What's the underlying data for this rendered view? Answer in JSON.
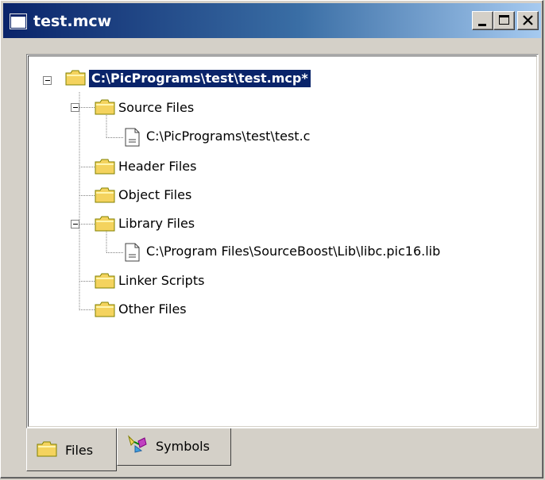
{
  "window": {
    "title": "test.mcw",
    "buttons": {
      "minimize": "minimize",
      "maximize": "maximize",
      "close": "close"
    }
  },
  "tree": {
    "root": {
      "label": "C:\\PicPrograms\\test\\test.mcp*",
      "selected": true
    },
    "items": [
      {
        "label": "Source Files",
        "kind": "folder",
        "expanded": true
      },
      {
        "label": "C:\\PicPrograms\\test\\test.c",
        "kind": "file"
      },
      {
        "label": "Header Files",
        "kind": "folder"
      },
      {
        "label": "Object Files",
        "kind": "folder"
      },
      {
        "label": "Library Files",
        "kind": "folder",
        "expanded": true
      },
      {
        "label": "C:\\Program Files\\SourceBoost\\Lib\\libc.pic16.lib",
        "kind": "file"
      },
      {
        "label": "Linker Scripts",
        "kind": "folder"
      },
      {
        "label": "Other Files",
        "kind": "folder"
      }
    ]
  },
  "tabs": [
    {
      "label": "Files",
      "active": true,
      "icon": "folder-icon"
    },
    {
      "label": "Symbols",
      "active": false,
      "icon": "symbols-icon"
    }
  ],
  "colors": {
    "selection": "#0a246a",
    "folder": "#f4d35e",
    "face": "#d4d0c8"
  }
}
